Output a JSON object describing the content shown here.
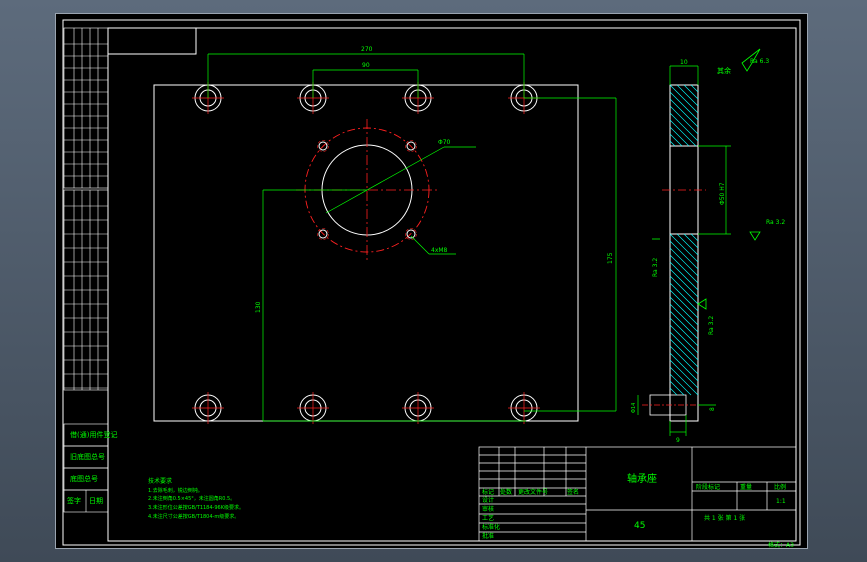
{
  "colors": {
    "frame": "#ffffff",
    "outline": "#ffffff",
    "dimension": "#00ff00",
    "centerline": "#ff2020",
    "hatch": "#00ffff",
    "background": "#000000"
  },
  "drawing": {
    "dims": {
      "top_outer": "270",
      "top_inner": "90",
      "bore": "Φ70",
      "vertical_right": "175",
      "vertical_left": "130",
      "side_thickness": "10",
      "side_bore": "Φ50 H7",
      "side_bottom_h": "Φ14",
      "side_bottom_w": "9",
      "side_right": "8"
    },
    "leader_holes": "4xM8",
    "roughness": [
      "Ra 6.3",
      "Ra 3.2",
      "Ra 3.2",
      "Ra 3.2"
    ],
    "roughness_other_prefix": "其余"
  },
  "left_strip": {
    "labels": [
      "借(通)用件登记",
      "旧底图总号",
      "底图总号",
      "签字",
      "日期"
    ]
  },
  "notes": {
    "title": "技术要求",
    "lines": [
      "1.去除毛刺，锐边倒钝。",
      "2.未注倒角0.5×45°，未注圆角R0.5。",
      "3.未注形位公差按GB/T1184-96K级要求。",
      "4.未注尺寸公差按GB/T1804-m级要求。"
    ]
  },
  "title_block": {
    "part_name": "轴承座",
    "material": "45",
    "rows": [
      "标记",
      "设计",
      "审核",
      "工艺",
      "标准化",
      "批准"
    ],
    "col_headers": [
      "处数",
      "分区",
      "更改文件号",
      "签名",
      "日期"
    ],
    "stage_label": "阶段标记",
    "weight_label": "重量",
    "scale_label": "比例",
    "scale_value": "1:1",
    "sheet_text": "共 1 张  第 1 张"
  },
  "footer": {
    "format": "格式：A3"
  }
}
